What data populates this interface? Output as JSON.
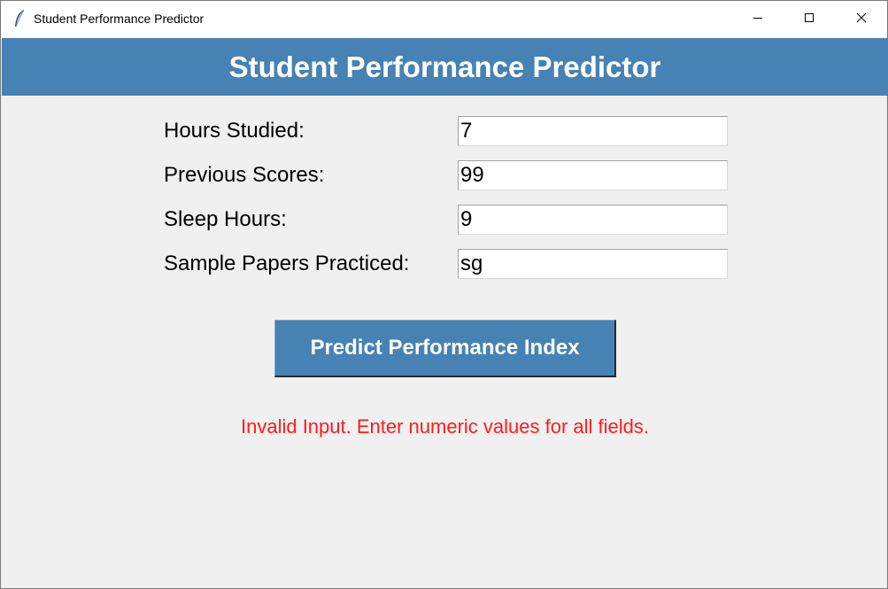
{
  "window": {
    "title": "Student Performance Predictor",
    "app_icon": "feather-icon",
    "controls": {
      "minimize_icon": "minimize-icon",
      "maximize_icon": "maximize-icon",
      "close_icon": "close-icon"
    }
  },
  "header": {
    "title": "Student Performance Predictor",
    "background": "#4682b4"
  },
  "form": {
    "fields": [
      {
        "label": "Hours Studied:",
        "value": "7"
      },
      {
        "label": "Previous Scores:",
        "value": "99"
      },
      {
        "label": "Sleep Hours:",
        "value": "9"
      },
      {
        "label": "Sample Papers Practiced:",
        "value": "sg"
      }
    ]
  },
  "predict_button": {
    "label": "Predict Performance Index",
    "background": "#4682b4"
  },
  "status": {
    "message": "Invalid Input. Enter numeric values for all fields.",
    "color": "#ff1a1a"
  }
}
